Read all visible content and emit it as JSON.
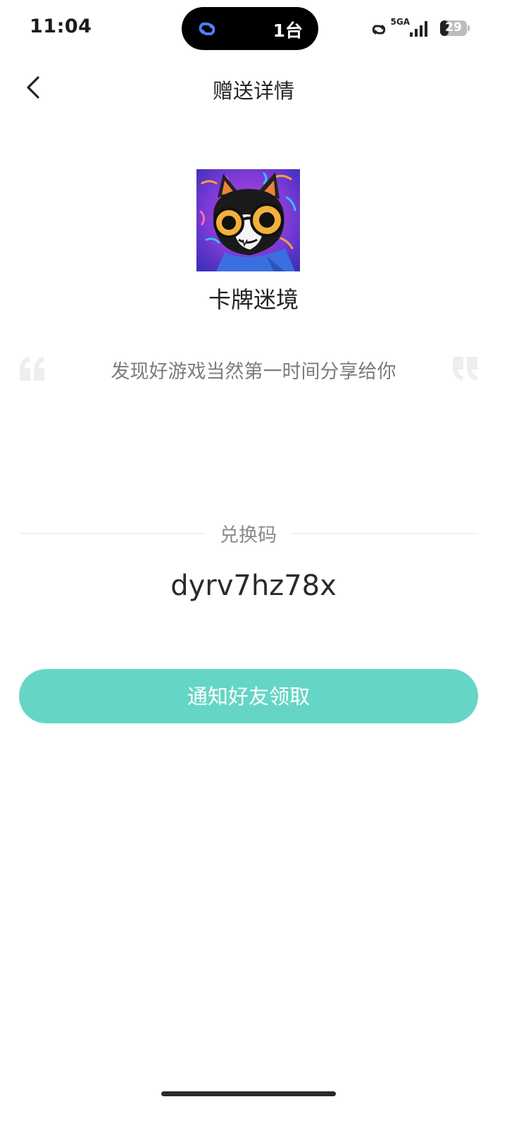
{
  "status_bar": {
    "time": "11:04",
    "island_count": "1台",
    "network": "5GA",
    "battery": "29",
    "link_color": "#4f7df5"
  },
  "nav": {
    "back_icon": "chevron-left-icon",
    "title": "赠送详情"
  },
  "game": {
    "name": "卡牌迷境",
    "cover_icon": "cat-with-goggles-artwork"
  },
  "gift": {
    "message": "发现好游戏当然第一时间分享给你",
    "code_label": "兑换码",
    "code": "dyrv7hz78x"
  },
  "actions": {
    "notify_label": "通知好友领取",
    "accent_color": "#65d6c5"
  }
}
